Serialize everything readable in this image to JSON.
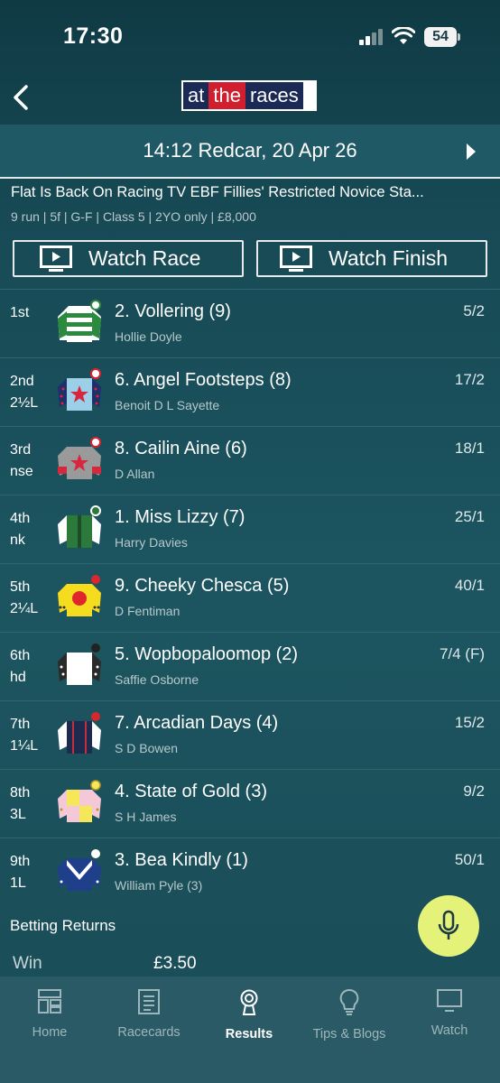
{
  "status": {
    "time": "17:30",
    "battery": "54"
  },
  "logo": {
    "part1": "at",
    "part2": "the",
    "part3": "races"
  },
  "race": {
    "header": "14:12 Redcar, 20 Apr 26",
    "name": "Flat Is Back On Racing TV EBF Fillies' Restricted Novice Sta...",
    "meta": "9 run | 5f | G-F | Class 5 | 2YO only | £8,000"
  },
  "buttons": {
    "watch_race": "Watch Race",
    "watch_finish": "Watch Finish"
  },
  "runners": [
    {
      "pos": "1st",
      "margin": "",
      "horse": "2. Vollering (9)",
      "jockey": "Hollie Doyle",
      "odds": "5/2",
      "silk": "green-hoops"
    },
    {
      "pos": "2nd",
      "margin": "2½L",
      "horse": "6. Angel Footsteps (8)",
      "jockey": "Benoit D L Sayette",
      "odds": "17/2",
      "silk": "lightblue-star"
    },
    {
      "pos": "3rd",
      "margin": "nse",
      "horse": "8. Cailin Aine (6)",
      "jockey": "D Allan",
      "odds": "18/1",
      "silk": "grey-star"
    },
    {
      "pos": "4th",
      "margin": "nk",
      "horse": "1. Miss Lizzy (7)",
      "jockey": "Harry Davies",
      "odds": "25/1",
      "silk": "green-white"
    },
    {
      "pos": "5th",
      "margin": "2¼L",
      "horse": "9. Cheeky Chesca (5)",
      "jockey": "D Fentiman",
      "odds": "40/1",
      "silk": "yellow-red"
    },
    {
      "pos": "6th",
      "margin": "hd",
      "horse": "5. Wopbopaloomop (2)",
      "jockey": "Saffie Osborne",
      "odds": "7/4  (F)",
      "silk": "white"
    },
    {
      "pos": "7th",
      "margin": "1¼L",
      "horse": "7. Arcadian Days (4)",
      "jockey": "S D Bowen",
      "odds": "15/2",
      "silk": "navy-red"
    },
    {
      "pos": "8th",
      "margin": "3L",
      "horse": "4. State of Gold (3)",
      "jockey": "S H James",
      "odds": "9/2",
      "silk": "yellow-pink"
    },
    {
      "pos": "9th",
      "margin": "1L",
      "horse": "3. Bea Kindly (1)",
      "jockey": "William Pyle (3)",
      "odds": "50/1",
      "silk": "blue-chevron"
    }
  ],
  "betting": {
    "title": "Betting Returns",
    "win_label": "Win",
    "win_value": "£3.50"
  },
  "tabs": [
    {
      "label": "Home",
      "icon": "home-icon",
      "active": false
    },
    {
      "label": "Racecards",
      "icon": "racecard-icon",
      "active": false
    },
    {
      "label": "Results",
      "icon": "results-icon",
      "active": true
    },
    {
      "label": "Tips & Blogs",
      "icon": "lightbulb-icon",
      "active": false
    },
    {
      "label": "Watch",
      "icon": "tv-icon",
      "active": false
    }
  ],
  "colors": {
    "accent_mic": "#e4f27a",
    "background": "#1c5560",
    "tab_bar": "#2a5a66"
  }
}
